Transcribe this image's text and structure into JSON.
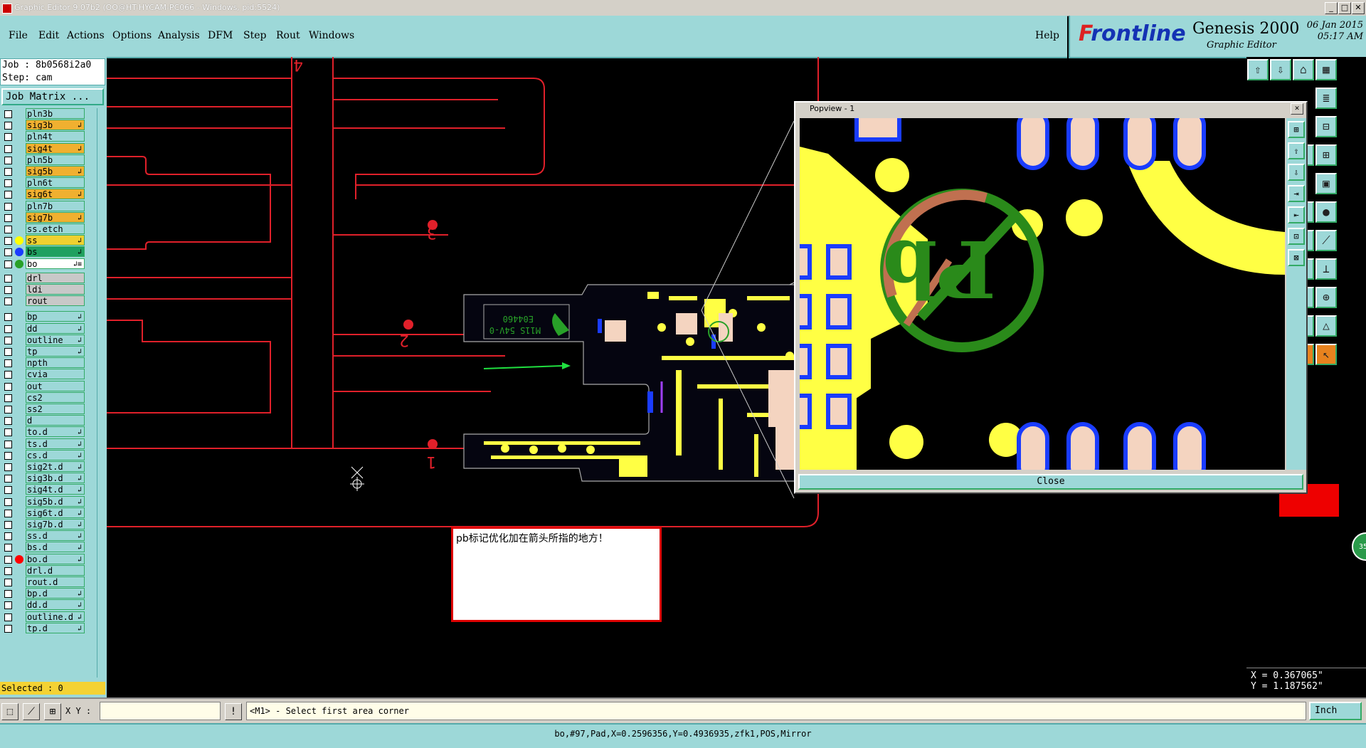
{
  "window": {
    "title": "Graphic Editor 9.07b2 (OO@HT-HYCAM-PC066 - Windows, pid:5524)",
    "min": "_",
    "max": "□",
    "close": "✕"
  },
  "menu": {
    "items": [
      "File",
      "Edit",
      "Actions",
      "Options",
      "Analysis",
      "DFM",
      "Step",
      "Rout",
      "Windows"
    ],
    "help": "Help"
  },
  "brand": {
    "logo_pre": "F",
    "logo_rest": "rontline",
    "product": "Genesis 2000",
    "subtitle": "Graphic Editor",
    "date": "06 Jan 2015",
    "time": "05:17 AM"
  },
  "job": {
    "job_line": "Job : 8b0568i2a0",
    "step_line": "Step: cam",
    "matrix_label": "Job Matrix ..."
  },
  "layers": [
    {
      "name": "pln3b",
      "color": "#9dd8d8",
      "mark": ""
    },
    {
      "name": "sig3b",
      "color": "#f0b030",
      "mark": "↲"
    },
    {
      "name": "pln4t",
      "color": "#9dd8d8",
      "mark": ""
    },
    {
      "name": "sig4t",
      "color": "#f0b030",
      "mark": "↲"
    },
    {
      "name": "pln5b",
      "color": "#9dd8d8",
      "mark": ""
    },
    {
      "name": "sig5b",
      "color": "#f0b030",
      "mark": "↲"
    },
    {
      "name": "pln6t",
      "color": "#9dd8d8",
      "mark": ""
    },
    {
      "name": "sig6t",
      "color": "#f0b030",
      "mark": "↲"
    },
    {
      "name": "pln7b",
      "color": "#9dd8d8",
      "mark": ""
    },
    {
      "name": "sig7b",
      "color": "#f0b030",
      "mark": "↲"
    },
    {
      "name": "ss.etch",
      "color": "#9dd8d8",
      "mark": ""
    },
    {
      "name": "ss",
      "color": "#f0d030",
      "mark": "↲",
      "dot": "#ffff00"
    },
    {
      "name": "bs",
      "color": "#20a060",
      "mark": "↲",
      "dot": "#1a3cff"
    },
    {
      "name": "bo",
      "color": "#ffffff",
      "mark": "↲≡",
      "dot": "#28a028"
    },
    {
      "name": "drl",
      "color": "#c8c8c8",
      "mark": ""
    },
    {
      "name": "ldi",
      "color": "#c8c8c8",
      "mark": ""
    },
    {
      "name": "rout",
      "color": "#c8c8c8",
      "mark": ""
    },
    {
      "name": "bp",
      "color": "#9dd8d8",
      "mark": "↲"
    },
    {
      "name": "dd",
      "color": "#9dd8d8",
      "mark": "↲"
    },
    {
      "name": "outline",
      "color": "#9dd8d8",
      "mark": "↲"
    },
    {
      "name": "tp",
      "color": "#9dd8d8",
      "mark": "↲"
    },
    {
      "name": "npth",
      "color": "#9dd8d8",
      "mark": ""
    },
    {
      "name": "cvia",
      "color": "#9dd8d8",
      "mark": ""
    },
    {
      "name": "out",
      "color": "#9dd8d8",
      "mark": ""
    },
    {
      "name": "cs2",
      "color": "#9dd8d8",
      "mark": ""
    },
    {
      "name": "ss2",
      "color": "#9dd8d8",
      "mark": ""
    },
    {
      "name": "d",
      "color": "#9dd8d8",
      "mark": ""
    },
    {
      "name": "to.d",
      "color": "#9dd8d8",
      "mark": "↲"
    },
    {
      "name": "ts.d",
      "color": "#9dd8d8",
      "mark": "↲"
    },
    {
      "name": "cs.d",
      "color": "#9dd8d8",
      "mark": "↲"
    },
    {
      "name": "sig2t.d",
      "color": "#9dd8d8",
      "mark": "↲"
    },
    {
      "name": "sig3b.d",
      "color": "#9dd8d8",
      "mark": "↲"
    },
    {
      "name": "sig4t.d",
      "color": "#9dd8d8",
      "mark": "↲"
    },
    {
      "name": "sig5b.d",
      "color": "#9dd8d8",
      "mark": "↲"
    },
    {
      "name": "sig6t.d",
      "color": "#9dd8d8",
      "mark": "↲"
    },
    {
      "name": "sig7b.d",
      "color": "#9dd8d8",
      "mark": "↲"
    },
    {
      "name": "ss.d",
      "color": "#9dd8d8",
      "mark": "↲"
    },
    {
      "name": "bs.d",
      "color": "#9dd8d8",
      "mark": "↲"
    },
    {
      "name": "bo.d",
      "color": "#9dd8d8",
      "mark": "↲",
      "dot": "#ff0000"
    },
    {
      "name": "drl.d",
      "color": "#9dd8d8",
      "mark": ""
    },
    {
      "name": "rout.d",
      "color": "#9dd8d8",
      "mark": ""
    },
    {
      "name": "bp.d",
      "color": "#9dd8d8",
      "mark": "↲"
    },
    {
      "name": "dd.d",
      "color": "#9dd8d8",
      "mark": "↲"
    },
    {
      "name": "outline.d",
      "color": "#9dd8d8",
      "mark": "↲"
    },
    {
      "name": "tp.d",
      "color": "#9dd8d8",
      "mark": "↲"
    }
  ],
  "selected": "Selected : 0",
  "canvas": {
    "labels": [
      "4",
      "3",
      "2",
      "1"
    ],
    "board_text_1": "E04460",
    "board_text_2": "M11S 54V-0"
  },
  "popview": {
    "title": "Popview - 1",
    "close_label": "Close",
    "tools": [
      "⊞",
      "⇪",
      "⇩",
      "⇥",
      "⇤",
      "⊡",
      "⊠"
    ]
  },
  "note": "pb标记优化加在箭头所指的地方！",
  "coords": {
    "x": "X = 0.367065\"",
    "y": "Y = 1.187562\""
  },
  "bottom": {
    "xy_label": "X Y :",
    "xy_value": "",
    "message": "<M1> - Select first area corner",
    "unit": "Inch"
  },
  "status": "bo,#97,Pad,X=0.2596356,Y=0.4936935,zfk1,POS,Mirror",
  "side_badge": "35"
}
